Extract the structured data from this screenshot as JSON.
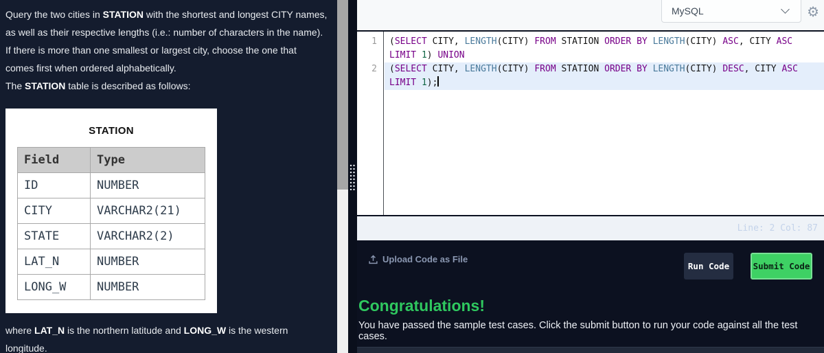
{
  "problem": {
    "statement": [
      [
        {
          "t": "Query the two cities in "
        },
        {
          "t": "STATION",
          "b": true
        },
        {
          "t": " with the shortest and longest CITY names,"
        }
      ],
      [
        {
          "t": "as well as their respective lengths (i.e.: number of characters in the name)."
        }
      ],
      [
        {
          "t": "If there is more than one smallest or largest city, choose the one that"
        }
      ],
      [
        {
          "t": "comes first when ordered alphabetically."
        }
      ],
      [
        {
          "t": "The "
        },
        {
          "t": "STATION",
          "b": true
        },
        {
          "t": " table is described as follows:"
        }
      ]
    ],
    "table": {
      "title": "STATION",
      "headers": [
        "Field",
        "Type"
      ],
      "rows": [
        [
          "ID",
          "NUMBER"
        ],
        [
          "CITY",
          "VARCHAR2(21)"
        ],
        [
          "STATE",
          "VARCHAR2(2)"
        ],
        [
          "LAT_N",
          "NUMBER"
        ],
        [
          "LONG_W",
          "NUMBER"
        ]
      ]
    },
    "footer": [
      [
        {
          "t": "where "
        },
        {
          "t": "LAT_N",
          "b": true
        },
        {
          "t": " is the northern latitude and "
        },
        {
          "t": "LONG_W",
          "b": true
        },
        {
          "t": " is the western"
        }
      ],
      [
        {
          "t": "longitude."
        }
      ]
    ]
  },
  "editor": {
    "language": "MySQL",
    "status": "Line: 2 Col: 87",
    "cursor_after_last": true,
    "lines": [
      {
        "number": "1",
        "highlight": false,
        "rows": [
          [
            {
              "t": "(",
              "c": "p"
            },
            {
              "t": "SELECT",
              "c": "k"
            },
            {
              "t": " CITY, ",
              "c": "p"
            },
            {
              "t": "LENGTH",
              "c": "f"
            },
            {
              "t": "(CITY) ",
              "c": "p"
            },
            {
              "t": "FROM",
              "c": "k"
            },
            {
              "t": " STATION ",
              "c": "p"
            },
            {
              "t": "ORDER",
              "c": "k"
            },
            {
              "t": " ",
              "c": "p"
            },
            {
              "t": "BY",
              "c": "k"
            },
            {
              "t": " ",
              "c": "p"
            },
            {
              "t": "LENGTH",
              "c": "f"
            },
            {
              "t": "(CITY) ",
              "c": "p"
            },
            {
              "t": "ASC",
              "c": "k"
            },
            {
              "t": ", CITY ",
              "c": "p"
            },
            {
              "t": "ASC",
              "c": "k"
            }
          ],
          [
            {
              "t": "LIMIT",
              "c": "k"
            },
            {
              "t": " ",
              "c": "p"
            },
            {
              "t": "1",
              "c": "n"
            },
            {
              "t": ") ",
              "c": "p"
            },
            {
              "t": "UNION",
              "c": "k"
            }
          ]
        ]
      },
      {
        "number": "2",
        "highlight": true,
        "rows": [
          [
            {
              "t": "(",
              "c": "p"
            },
            {
              "t": "SELECT",
              "c": "k"
            },
            {
              "t": " CITY, ",
              "c": "p"
            },
            {
              "t": "LENGTH",
              "c": "f"
            },
            {
              "t": "(CITY) ",
              "c": "p"
            },
            {
              "t": "FROM",
              "c": "k"
            },
            {
              "t": " STATION ",
              "c": "p"
            },
            {
              "t": "ORDER",
              "c": "k"
            },
            {
              "t": " ",
              "c": "p"
            },
            {
              "t": "BY",
              "c": "k"
            },
            {
              "t": " ",
              "c": "p"
            },
            {
              "t": "LENGTH",
              "c": "f"
            },
            {
              "t": "(CITY) ",
              "c": "p"
            },
            {
              "t": "DESC",
              "c": "k"
            },
            {
              "t": ", CITY ",
              "c": "p"
            },
            {
              "t": "ASC",
              "c": "k"
            }
          ],
          [
            {
              "t": "LIMIT",
              "c": "k"
            },
            {
              "t": " ",
              "c": "p"
            },
            {
              "t": "1",
              "c": "n"
            },
            {
              "t": ");",
              "c": "p"
            }
          ]
        ]
      }
    ]
  },
  "actions": {
    "upload_label": "Upload Code as File",
    "run_label": "Run Code",
    "submit_label": "Submit Code"
  },
  "result": {
    "title": "Congratulations!",
    "message": "You have passed the sample test cases. Click the submit button to run your code against all the test cases."
  },
  "icons": {
    "gear": "⚙",
    "chevron_down": "chevron-down-shape",
    "upload": "arrow-up-from-tray"
  },
  "colors": {
    "panel_dark": "#141c2e",
    "submit_green": "#3ed164",
    "congrats_green": "#2fc85f",
    "keyword_purple": "#770088",
    "function_blue": "#4a7a9b",
    "number_green": "#116644",
    "active_line_highlight": "#e4eefb"
  }
}
